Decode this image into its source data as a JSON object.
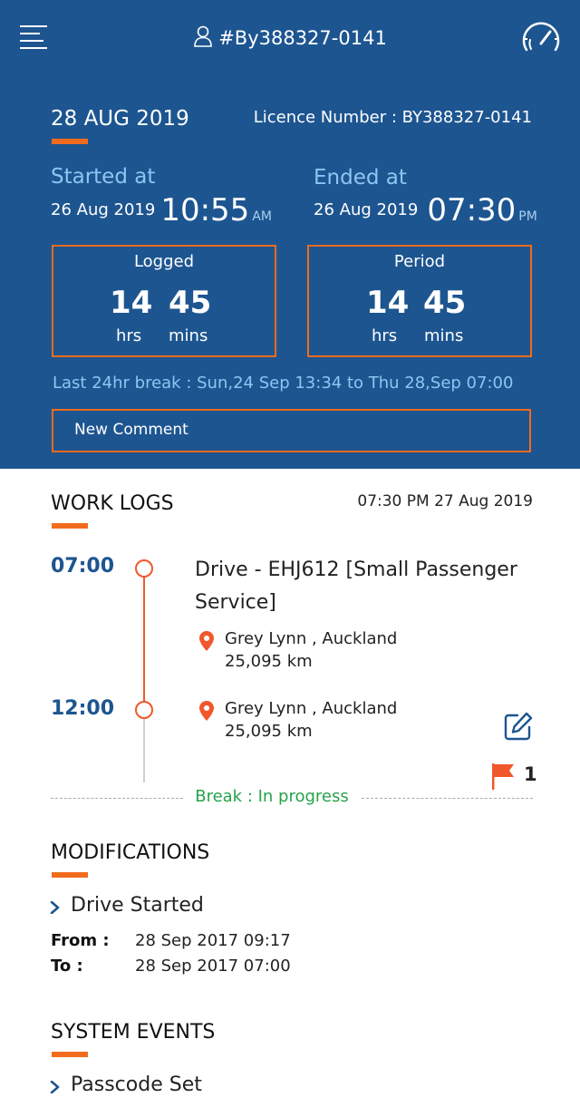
{
  "header": {
    "title": "#By388327-0141",
    "date": "28 AUG 2019",
    "licence": "Licence Number : BY388327-0141",
    "started": {
      "label": "Started at",
      "date": "26 Aug 2019",
      "time": "10:55",
      "ampm": "AM"
    },
    "ended": {
      "label": "Ended at",
      "date": "26 Aug 2019",
      "time": "07:30",
      "ampm": "PM"
    },
    "logged": {
      "title": "Logged",
      "hrs": "14",
      "mins": "45",
      "hrs_unit": "hrs",
      "mins_unit": "mins"
    },
    "period": {
      "title": "Period",
      "hrs": "14",
      "mins": "45",
      "hrs_unit": "hrs",
      "mins_unit": "mins"
    },
    "last_break": "Last 24hr break : Sun,24 Sep 13:34 to Thu 28,Sep 07:00",
    "comment_placeholder": "New Comment"
  },
  "work_logs": {
    "title": "WORK LOGS",
    "date": "07:30 PM 27 Aug 2019",
    "entries": [
      {
        "time": "07:00",
        "title": "Drive - EHJ612 [Small Passenger Service]",
        "location": "Grey Lynn , Auckland",
        "km": "25,095 km"
      },
      {
        "time": "12:00",
        "location": "Grey Lynn , Auckland",
        "km": "25,095 km"
      }
    ],
    "flag_count": "1",
    "break_status": "Break : In progress"
  },
  "modifications": {
    "title": "MODIFICATIONS",
    "item": "Drive Started",
    "from_label": "From :",
    "from_value": "28 Sep 2017 09:17",
    "to_label": "To :",
    "to_value": "28 Sep 2017 07:00"
  },
  "system_events": {
    "title": "SYSTEM EVENTS",
    "item": "Passcode Set"
  },
  "colors": {
    "header_bg": "#1d5590",
    "accent": "#f26b1d",
    "light_blue": "#8ec5f2",
    "green": "#27a34a"
  }
}
